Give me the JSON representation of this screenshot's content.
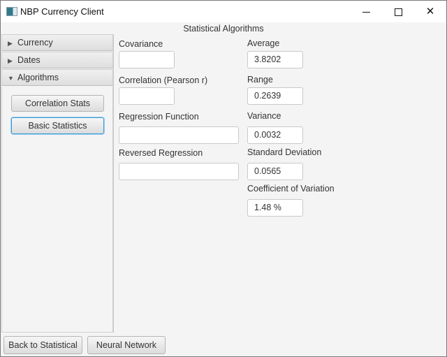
{
  "window": {
    "title": "NBP Currency Client",
    "controls": {
      "minimize": "minimize-icon",
      "maximize": "maximize-icon",
      "close": "close-icon",
      "close_glyph": "✕"
    }
  },
  "header": {
    "title": "Statistical Algorithms"
  },
  "accordion": {
    "panes": [
      {
        "label": "Currency",
        "expanded": false,
        "arrow": "▶"
      },
      {
        "label": "Dates",
        "expanded": false,
        "arrow": "▶"
      },
      {
        "label": "Algorithms",
        "expanded": true,
        "arrow": "▼"
      }
    ],
    "buttons": [
      {
        "label": "Correlation Stats",
        "focused": false
      },
      {
        "label": "Basic Statistics",
        "focused": true
      }
    ]
  },
  "left_fields": [
    {
      "label": "Covariance",
      "value": ""
    },
    {
      "label": "Correlation (Pearson r)",
      "value": ""
    },
    {
      "label": "Regression Function",
      "value": ""
    },
    {
      "label": "Reversed Regression",
      "value": ""
    }
  ],
  "right_fields": [
    {
      "label": "Average",
      "value": "3.8202"
    },
    {
      "label": "Range",
      "value": "0.2639"
    },
    {
      "label": "Variance",
      "value": "0.0032"
    },
    {
      "label": "Standard Deviation",
      "value": "0.0565"
    },
    {
      "label": "Coefficient of Variation",
      "value": "1.48 %"
    }
  ],
  "footer": {
    "back_label": "Back to Statistical",
    "neural_label": "Neural Network"
  }
}
